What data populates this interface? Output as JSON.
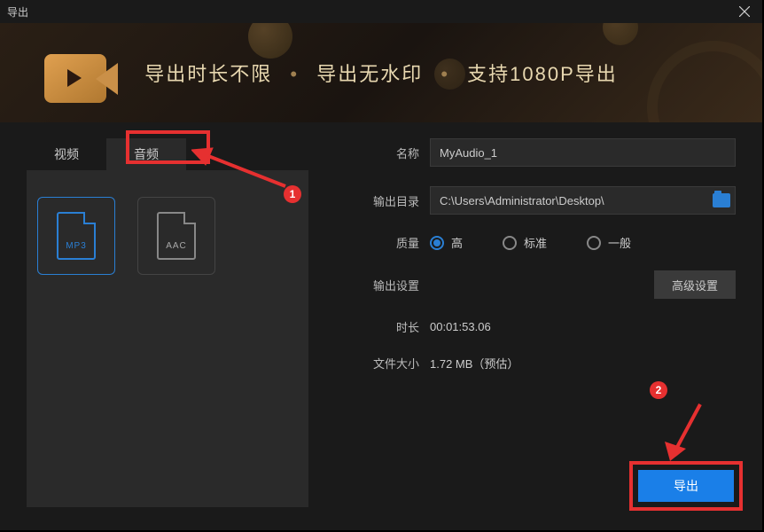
{
  "titlebar": {
    "title": "导出"
  },
  "banner": {
    "part1": "导出时长不限",
    "part2": "导出无水印",
    "part3": "支持1080P导出"
  },
  "tabs": {
    "video": "视频",
    "audio": "音频"
  },
  "formats": {
    "mp3": "MP3",
    "aac": "AAC"
  },
  "form": {
    "name_label": "名称",
    "name_value": "MyAudio_1",
    "path_label": "输出目录",
    "path_value": "C:\\Users\\Administrator\\Desktop\\",
    "quality_label": "质量",
    "quality_options": {
      "high": "高",
      "standard": "标准",
      "normal": "一般"
    },
    "output_settings_label": "输出设置",
    "advanced_btn": "高级设置",
    "duration_label": "时长",
    "duration_value": "00:01:53.06",
    "filesize_label": "文件大小",
    "filesize_value": "1.72 MB（预估）"
  },
  "export_btn": "导出",
  "annotations": {
    "badge1": "1",
    "badge2": "2"
  }
}
